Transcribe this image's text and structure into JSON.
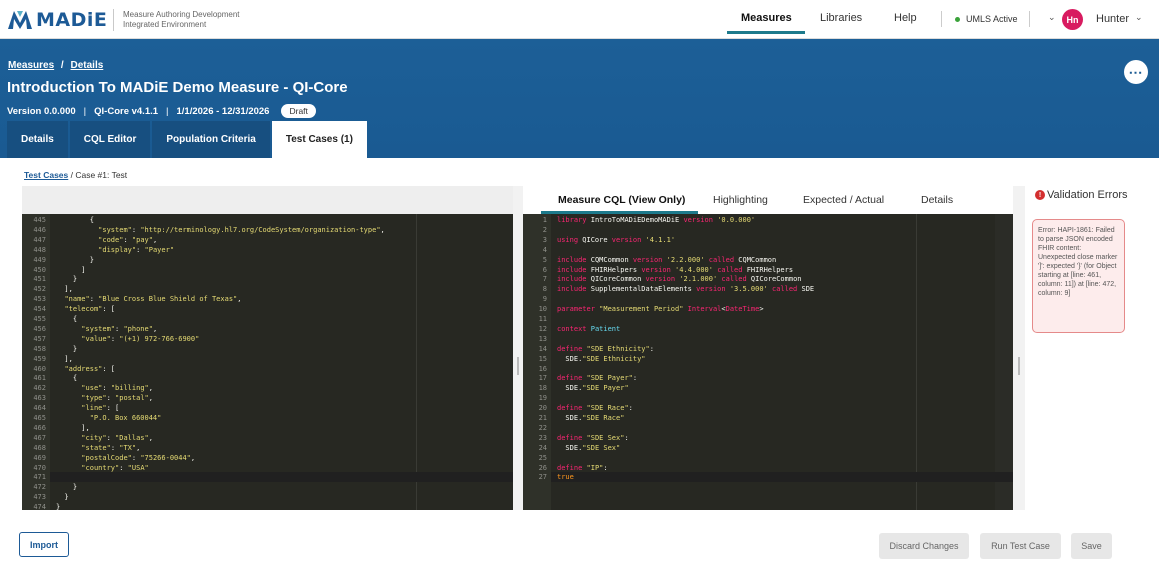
{
  "nav": {
    "logo_text": "MADiE",
    "logo_subtitle": "Measure Authoring Development Integrated Environment",
    "items": [
      "Measures",
      "Libraries",
      "Help"
    ],
    "umls_status": "UMLS Active",
    "avatar_initials": "Hn",
    "username": "Hunter"
  },
  "header": {
    "breadcrumb_measures": "Measures",
    "breadcrumb_sep": "/",
    "breadcrumb_details": "Details",
    "title": "Introduction To MADiE Demo Measure - QI-Core",
    "version": "Version 0.0.000",
    "model": "QI-Core v4.1.1",
    "period": "1/1/2026 - 12/31/2026",
    "status": "Draft",
    "tabs": [
      "Details",
      "CQL Editor",
      "Population Criteria",
      "Test Cases (1)"
    ],
    "active_tab": "Test Cases (1)",
    "more_icon": "more-horizontal-icon"
  },
  "subcrumb": {
    "link": "Test Cases",
    "rest": " / Case #1: Test"
  },
  "json_editor": {
    "lines": [
      {
        "n": "445",
        "t": "        {"
      },
      {
        "n": "446",
        "t": "          \"system\": \"http://terminology.hl7.org/CodeSystem/organization-type\","
      },
      {
        "n": "447",
        "t": "          \"code\": \"pay\","
      },
      {
        "n": "448",
        "t": "          \"display\": \"Payer\""
      },
      {
        "n": "449",
        "t": "        }"
      },
      {
        "n": "450",
        "t": "      ]"
      },
      {
        "n": "451",
        "t": "    }"
      },
      {
        "n": "452",
        "t": "  ],"
      },
      {
        "n": "453",
        "t": "  \"name\": \"Blue Cross Blue Shield of Texas\","
      },
      {
        "n": "454",
        "t": "  \"telecom\": ["
      },
      {
        "n": "455",
        "t": "    {"
      },
      {
        "n": "456",
        "t": "      \"system\": \"phone\","
      },
      {
        "n": "457",
        "t": "      \"value\": \"(+1) 972-766-6900\""
      },
      {
        "n": "458",
        "t": "    }"
      },
      {
        "n": "459",
        "t": "  ],"
      },
      {
        "n": "460",
        "t": "  \"address\": ["
      },
      {
        "n": "461",
        "t": "    {"
      },
      {
        "n": "462",
        "t": "      \"use\": \"billing\","
      },
      {
        "n": "463",
        "t": "      \"type\": \"postal\","
      },
      {
        "n": "464",
        "t": "      \"line\": ["
      },
      {
        "n": "465",
        "t": "        \"P.O. Box 660044\""
      },
      {
        "n": "466",
        "t": "      ],"
      },
      {
        "n": "467",
        "t": "      \"city\": \"Dallas\","
      },
      {
        "n": "468",
        "t": "      \"state\": \"TX\","
      },
      {
        "n": "469",
        "t": "      \"postalCode\": \"75266-0044\","
      },
      {
        "n": "470",
        "t": "      \"country\": \"USA\""
      },
      {
        "n": "471",
        "t": ""
      },
      {
        "n": "472",
        "t": "    }"
      },
      {
        "n": "473",
        "t": "  }"
      },
      {
        "n": "474",
        "t": "}"
      }
    ]
  },
  "cql_panel": {
    "tabs": [
      "Measure CQL (View Only)",
      "Highlighting",
      "Expected / Actual",
      "Details"
    ],
    "active_tab": "Measure CQL (View Only)",
    "lines": [
      {
        "n": "1",
        "t": "library IntroToMADiEDemoMADiE version '0.0.000'"
      },
      {
        "n": "2",
        "t": ""
      },
      {
        "n": "3",
        "t": "using QICore version '4.1.1'"
      },
      {
        "n": "4",
        "t": ""
      },
      {
        "n": "5",
        "t": "include CQMCommon version '2.2.000' called CQMCommon"
      },
      {
        "n": "6",
        "t": "include FHIRHelpers version '4.4.000' called FHIRHelpers"
      },
      {
        "n": "7",
        "t": "include QICoreCommon version '2.1.000' called QICoreCommon"
      },
      {
        "n": "8",
        "t": "include SupplementalDataElements version '3.5.000' called SDE"
      },
      {
        "n": "9",
        "t": ""
      },
      {
        "n": "10",
        "t": "parameter \"Measurement Period\" Interval<DateTime>"
      },
      {
        "n": "11",
        "t": ""
      },
      {
        "n": "12",
        "t": "context Patient"
      },
      {
        "n": "13",
        "t": ""
      },
      {
        "n": "14",
        "t": "define \"SDE Ethnicity\":"
      },
      {
        "n": "15",
        "t": "  SDE.\"SDE Ethnicity\""
      },
      {
        "n": "16",
        "t": ""
      },
      {
        "n": "17",
        "t": "define \"SDE Payer\":"
      },
      {
        "n": "18",
        "t": "  SDE.\"SDE Payer\""
      },
      {
        "n": "19",
        "t": ""
      },
      {
        "n": "20",
        "t": "define \"SDE Race\":"
      },
      {
        "n": "21",
        "t": "  SDE.\"SDE Race\""
      },
      {
        "n": "22",
        "t": ""
      },
      {
        "n": "23",
        "t": "define \"SDE Sex\":"
      },
      {
        "n": "24",
        "t": "  SDE.\"SDE Sex\""
      },
      {
        "n": "25",
        "t": ""
      },
      {
        "n": "26",
        "t": "define \"IP\":"
      },
      {
        "n": "27",
        "t": "true"
      }
    ]
  },
  "validation": {
    "title": "Validation Errors",
    "icon": "error-icon",
    "message": "Error: HAPI-1861: Failed to parse JSON encoded FHIR content: Unexpected close marker ']': expected '}' (for Object starting at [line: 461, column: 11]) at [line: 472, column: 9]"
  },
  "footer": {
    "import": "Import",
    "discard": "Discard Changes",
    "run": "Run Test Case",
    "save": "Save"
  },
  "colors": {
    "brand": "#1a5a92",
    "accent": "#1d7a8c",
    "editor_bg": "#272822",
    "error": "#d32f2f"
  }
}
